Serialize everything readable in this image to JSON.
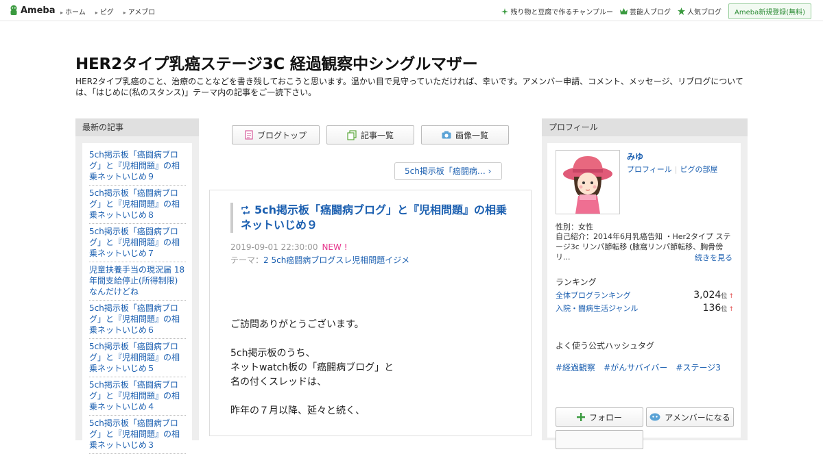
{
  "header": {
    "logo_text": "Ameba",
    "nav": [
      "ホーム",
      "ピグ",
      "アメブロ"
    ],
    "right_links": [
      "残り物と豆腐で作るチャンプルー",
      "芸能人ブログ",
      "人気ブログ"
    ],
    "signup": "Ameba新規登録(無料)"
  },
  "blog": {
    "title": "HER2タイプ乳癌ステージ3C 経過観察中シングルマザー",
    "description": "HER2タイプ乳癌のこと、治療のことなどを書き残しておこうと思います。温かい目で見守っていただければ、幸いです。アメンバー申請、コメント、メッセージ、リブログについては、「はじめに(私のスタンス)」テーマ内の記事をご一読下さい。"
  },
  "left_sidebar": {
    "heading": "最新の記事",
    "items": [
      "5ch掲示板「癌闘病ブログ」と『児相問題』の相乗ネットいじめ９",
      "5ch掲示板「癌闘病ブログ」と『児相問題』の相乗ネットいじめ８",
      "5ch掲示板「癌闘病ブログ」と『児相問題』の相乗ネットいじめ７",
      "児童扶養手当の現況届 18年間支給停止(所得制限)なんだけどね",
      "5ch掲示板「癌闘病ブログ」と『児相問題』の相乗ネットいじめ６",
      "5ch掲示板「癌闘病ブログ」と『児相問題』の相乗ネットいじめ５",
      "5ch掲示板「癌闘病ブログ」と『児相問題』の相乗ネットいじめ４",
      "5ch掲示板「癌闘病ブログ」と『児相問題』の相乗ネットいじめ３"
    ]
  },
  "center": {
    "buttons": [
      "ブログトップ",
      "記事一覧",
      "画像一覧"
    ],
    "next_link": "5ch掲示板「癌闘病…",
    "entry": {
      "title": "5ch掲示板「癌闘病ブログ」と『児相問題』の相乗ネットいじめ９",
      "date": "2019-09-01 22:30:00",
      "new_badge": "NEW !",
      "theme_label": "テーマ：",
      "theme": "2 5ch癌闘病ブログスレ児相問題イジメ",
      "body": [
        "ご訪問ありがとうございます。",
        "5ch掲示板のうち、",
        "ネットwatch板の「癌闘病ブログ」と",
        "名の付くスレッドは、",
        "昨年の７月以降、延々と続く、"
      ]
    }
  },
  "right_sidebar": {
    "heading": "プロフィール",
    "name": "みゆ",
    "links": [
      "プロフィール",
      "ピグの部屋"
    ],
    "gender": "性別：女性",
    "intro": "自己紹介：2014年6月乳癌告知 ・Her2タイプ ステージ3c リンパ節転移 (腋窩リンパ節転移、胸骨傍リ...",
    "more": "続きを見る",
    "ranking_heading": "ランキング",
    "rankings": [
      {
        "label": "全体ブログランキング",
        "value": "3,024",
        "unit": "位",
        "arrow": "↑"
      },
      {
        "label": "入院・闘病生活ジャンル",
        "value": "136",
        "unit": "位",
        "arrow": "↑"
      }
    ],
    "hashtag_heading": "よく使う公式ハッシュタグ",
    "hashtags": [
      "#経過観察",
      "#がんサバイバー",
      "#ステージ3"
    ],
    "follow": "フォロー",
    "amember": "アメンバーになる"
  },
  "colors": {
    "link": "#1b5fb0",
    "new": "#e6358c",
    "brand_green": "#2d8c36"
  }
}
